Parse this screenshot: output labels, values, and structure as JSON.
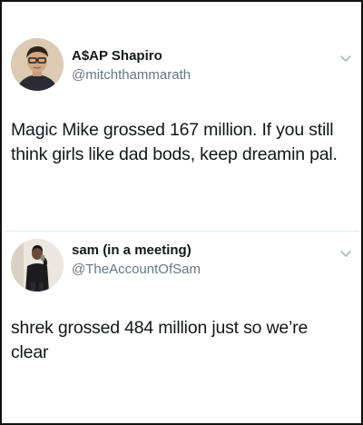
{
  "tweets": [
    {
      "display_name": "A$AP Shapiro",
      "handle": "@mitchthammarath",
      "text": "Magic Mike grossed 167 million. If you still think girls like dad bods, keep dreamin pal."
    },
    {
      "display_name": "sam (in a meeting)",
      "handle": "@TheAccountOfSam",
      "text": "shrek grossed 484 million just so we’re clear"
    }
  ],
  "icons": {
    "menu": "chevron-down-icon",
    "avatar": "avatar"
  },
  "colors": {
    "text": "#14171a",
    "handle": "#657786",
    "border": "#111111",
    "divider": "#e1e8ed"
  }
}
